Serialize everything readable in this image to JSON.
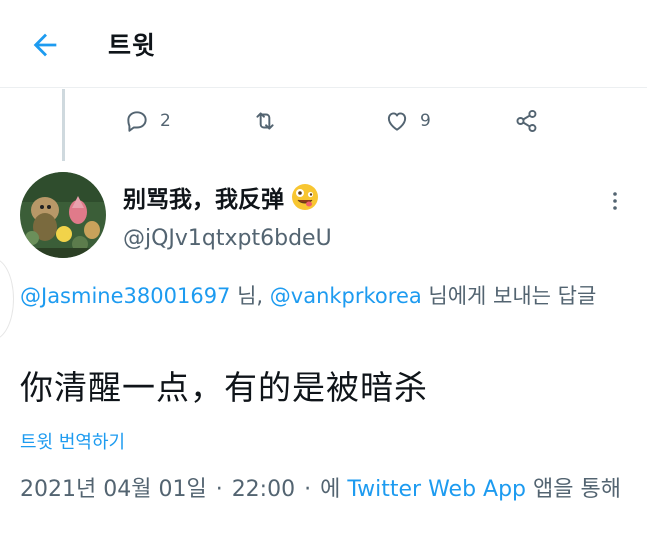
{
  "header": {
    "title": "트윗"
  },
  "actions": {
    "reply_count": "2",
    "retweet_count": "",
    "like_count": "9"
  },
  "tweet": {
    "display_name": "别骂我，我反弹",
    "handle": "@jQJv1qtxpt6bdeU",
    "reply_to": {
      "mention1": "@Jasmine38001697",
      "sep1": " 님, ",
      "mention2": "@vankprkorea",
      "suffix": " 님에게 보내는 답글"
    },
    "text": "你清醒一点，有的是被暗杀",
    "translate_label": "트윗 번역하기",
    "date": "2021년 04월 01일",
    "time": "22:00",
    "source_prefix": "에",
    "source": "Twitter Web App",
    "source_suffix": "앱을 통해"
  },
  "colors": {
    "accent": "#1d9bf0",
    "secondary_text": "#536471"
  },
  "icons": [
    "back-arrow-icon",
    "reply-icon",
    "retweet-icon",
    "like-icon",
    "share-icon",
    "more-vertical-icon",
    "emoji-icon"
  ]
}
